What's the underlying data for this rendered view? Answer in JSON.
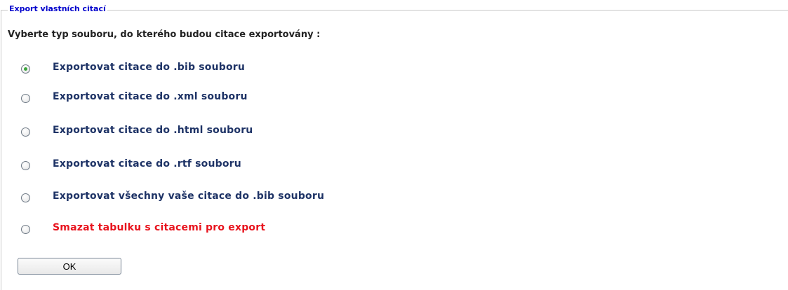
{
  "form": {
    "legend": "Export vlastních citací",
    "instruction": "Vyberte typ souboru, do kterého budou citace exportovány :",
    "options": [
      {
        "label": "Exportovat citace do .bib souboru",
        "checked": true,
        "color": "#1e3366"
      },
      {
        "label": "Exportovat citace do .xml souboru",
        "checked": false,
        "color": "#1e3366"
      },
      {
        "label": "Exportovat citace do .html souboru",
        "checked": false,
        "color": "#1e3366"
      },
      {
        "label": "Exportovat citace do .rtf souboru",
        "checked": false,
        "color": "#1e3366"
      },
      {
        "label": "Exportovat všechny vaše citace do .bib souboru",
        "checked": false,
        "color": "#1e3366"
      },
      {
        "label": "Smazat tabulku s citacemi pro export",
        "checked": false,
        "color": "#e8141e"
      }
    ],
    "submit_label": "OK"
  },
  "colors": {
    "legend": "#0000cc",
    "option_text": "#1e3366",
    "danger_text": "#e8141e",
    "radio_checked": "#3ba43b"
  },
  "icons": {
    "radio_unchecked": "radio-unchecked-icon",
    "radio_checked": "radio-checked-icon"
  }
}
